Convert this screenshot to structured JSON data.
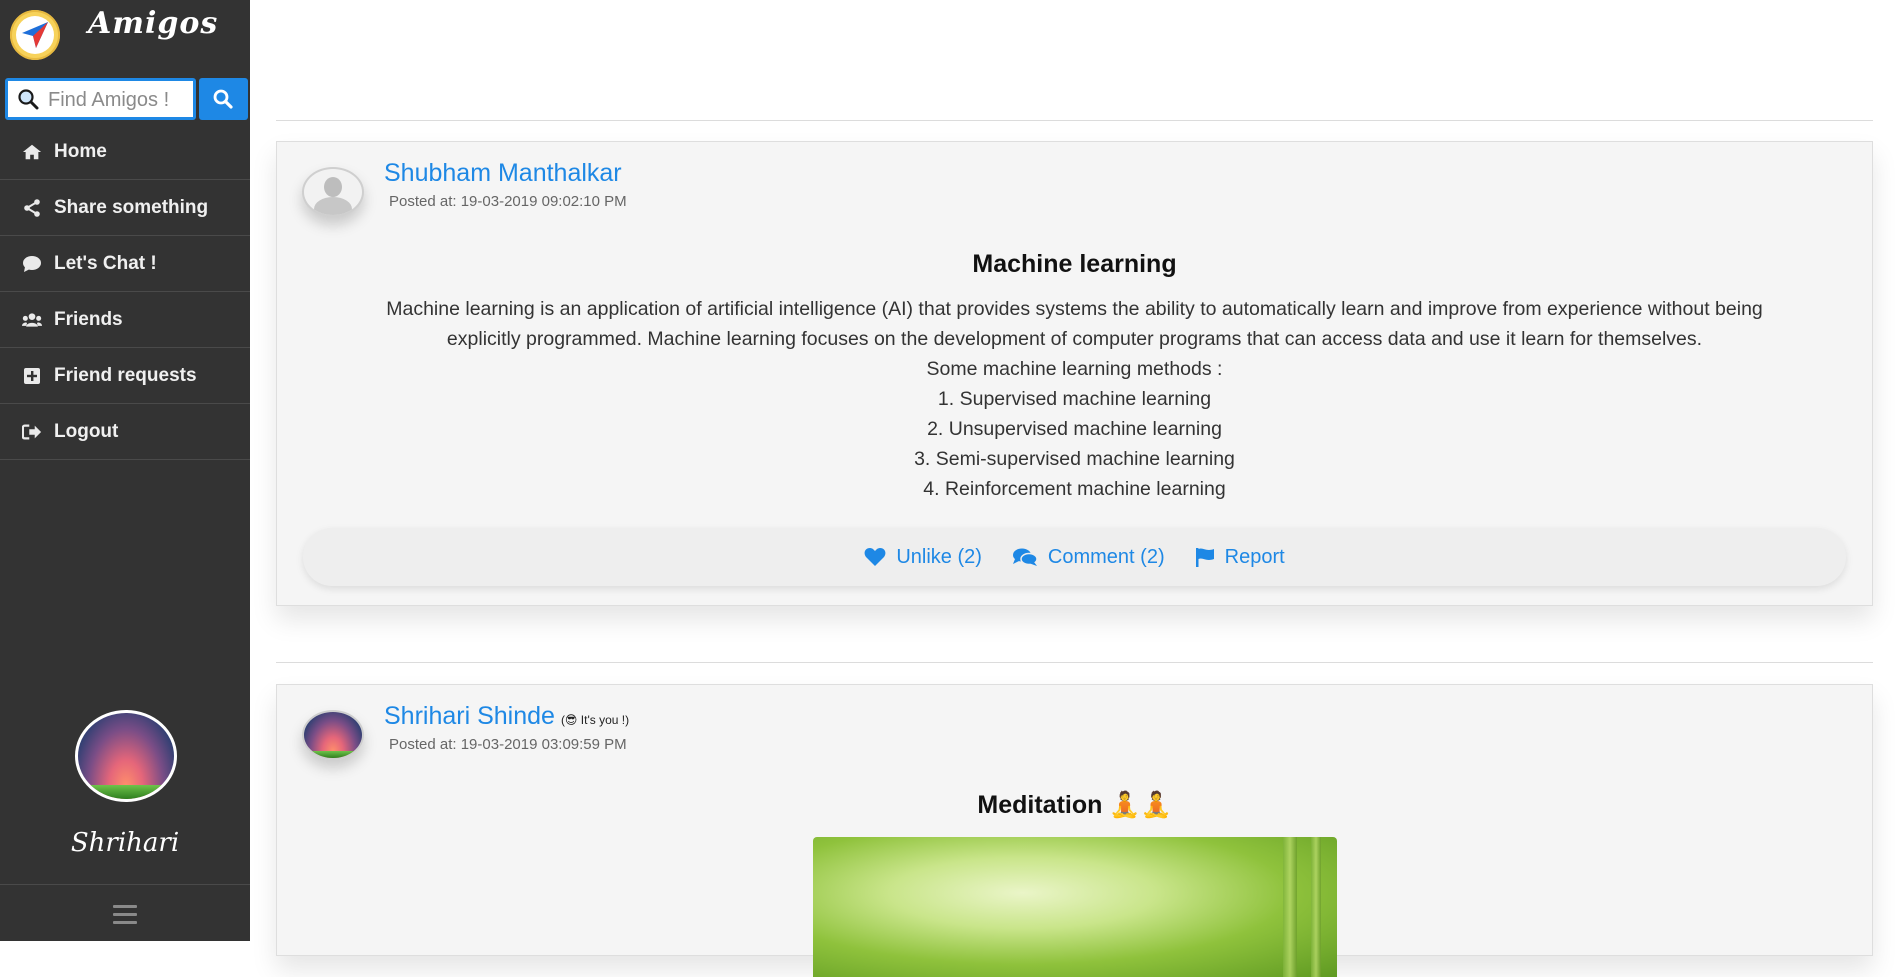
{
  "app": {
    "brand": "Amigos",
    "search_placeholder": "Find Amigos !"
  },
  "sidebar": {
    "items": [
      {
        "label": "Home",
        "icon": "home-icon"
      },
      {
        "label": "Share something",
        "icon": "share-icon"
      },
      {
        "label": "Let's Chat !",
        "icon": "chat-bubble-icon"
      },
      {
        "label": "Friends",
        "icon": "users-icon"
      },
      {
        "label": "Friend requests",
        "icon": "plus-square-icon"
      },
      {
        "label": "Logout",
        "icon": "sign-out-icon"
      }
    ],
    "profile_name": "Shrihari"
  },
  "posts": [
    {
      "author": "Shubham Manthalkar",
      "posted_at": "Posted at: 19-03-2019 09:02:10 PM",
      "title": "Machine learning",
      "body": [
        "Machine learning is an application of artificial intelligence (AI) that provides systems the ability to automatically learn and improve from experience without being explicitly programmed. Machine learning focuses on the development of computer programs that can access data and use it learn for themselves.",
        "Some machine learning methods :",
        "1. Supervised machine learning",
        "2. Unsupervised machine learning",
        "3. Semi-supervised machine learning",
        "4. Reinforcement machine learning"
      ],
      "actions": {
        "like": "Unlike (2)",
        "comment": "Comment (2)",
        "report": "Report"
      }
    },
    {
      "author": "Shrihari Shinde",
      "badge": "(😎 It's you !)",
      "posted_at": "Posted at: 19-03-2019 03:09:59 PM",
      "title": "Meditation 🧘🧘"
    }
  ],
  "colors": {
    "sidebar_bg": "#333333",
    "accent": "#1e88e5",
    "card_bg": "#f5f5f5"
  }
}
